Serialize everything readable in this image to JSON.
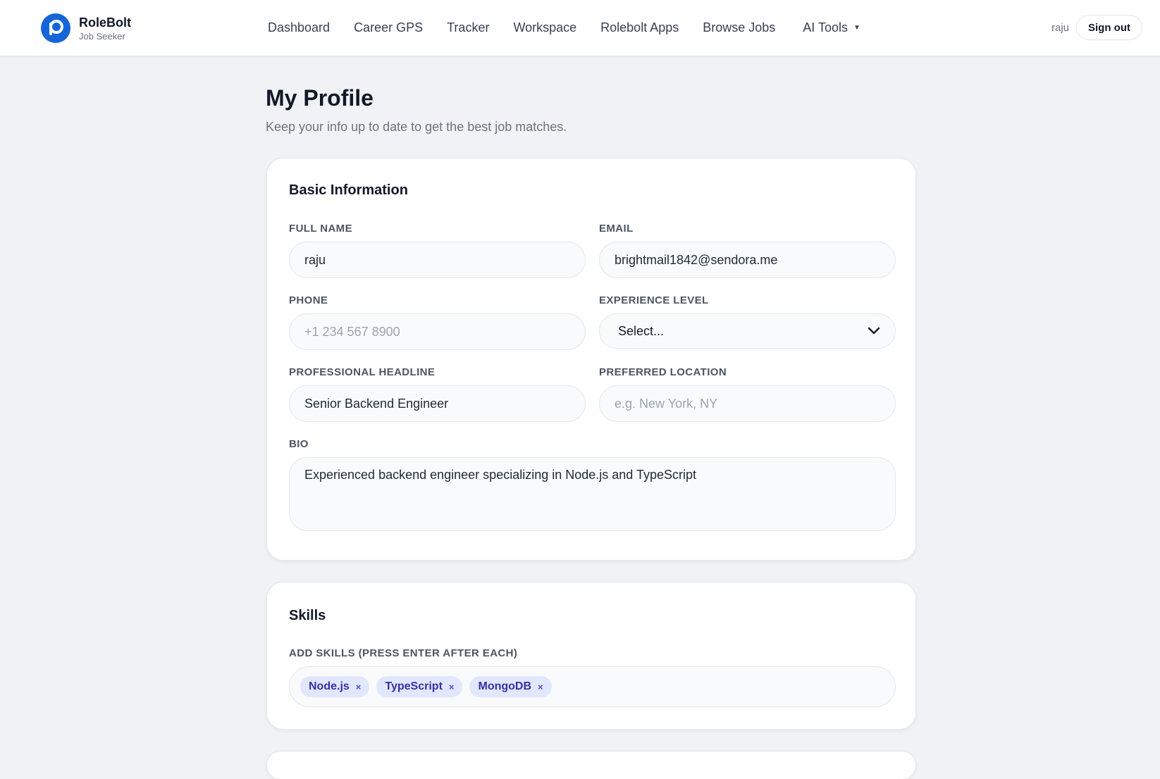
{
  "header": {
    "brand_name": "RoleBolt",
    "brand_sub": "Job Seeker",
    "nav": [
      "Dashboard",
      "Career GPS",
      "Tracker",
      "Workspace",
      "Rolebolt Apps",
      "Browse Jobs"
    ],
    "ai_tools": "AI Tools",
    "username": "raju",
    "sign_out": "Sign out"
  },
  "page": {
    "title": "My Profile",
    "subtitle": "Keep your info up to date to get the best job matches."
  },
  "basic": {
    "title": "Basic Information",
    "full_name_label": "FULL NAME",
    "full_name_value": "raju",
    "email_label": "EMAIL",
    "email_value": "brightmail1842@sendora.me",
    "phone_label": "PHONE",
    "phone_placeholder": "+1 234 567 8900",
    "experience_label": "EXPERIENCE LEVEL",
    "experience_value": "Select...",
    "headline_label": "PROFESSIONAL HEADLINE",
    "headline_value": "Senior Backend Engineer",
    "location_label": "PREFERRED LOCATION",
    "location_placeholder": "e.g. New York, NY",
    "bio_label": "BIO",
    "bio_value": "Experienced backend engineer specializing in Node.js and TypeScript"
  },
  "skills": {
    "title": "Skills",
    "label": "ADD SKILLS (PRESS ENTER AFTER EACH)",
    "chips": [
      "Node.js",
      "TypeScript",
      "MongoDB"
    ],
    "remove_glyph": "×"
  },
  "colors": {
    "brand": "#1565d8",
    "background": "#f1f2f5",
    "chip_bg": "#e0e7ff",
    "chip_text": "#3730a3"
  }
}
